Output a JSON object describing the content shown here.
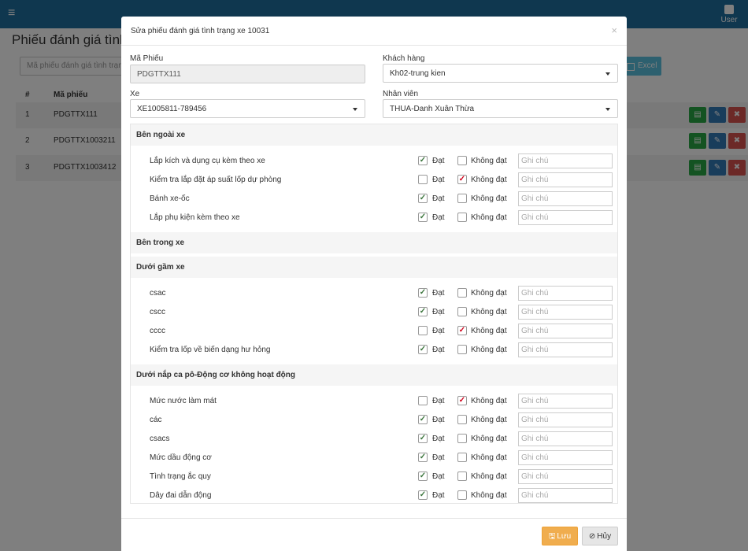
{
  "app": {
    "user_label": "User",
    "page_title": "Phiếu đánh giá tình",
    "search_placeholder": "Mã phiếu đánh giá tình trạng",
    "excel_label": "Excel"
  },
  "table": {
    "headers": [
      "#",
      "Mã phiếu"
    ],
    "rows": [
      {
        "no": "1",
        "code": "PDGTTX111"
      },
      {
        "no": "2",
        "code": "PDGTTX1003211"
      },
      {
        "no": "3",
        "code": "PDGTTX1003412"
      }
    ]
  },
  "modal": {
    "title": "Sửa phiếu đánh giá tình trạng xe 10031",
    "close_glyph": "×",
    "fields": {
      "code_label": "Mã Phiếu",
      "code_value": "PDGTTX111",
      "customer_label": "Khách hàng",
      "customer_value": "Kh02-trung kien",
      "vehicle_label": "Xe",
      "vehicle_value": "XE1005811-789456",
      "staff_label": "Nhân viên",
      "staff_value": "THUA-Danh Xuân Thừa"
    },
    "ok_label": "Đạt",
    "fail_label": "Không đạt",
    "note_placeholder": "Ghi chú",
    "sections": [
      {
        "title": "Bên ngoài xe",
        "items": [
          {
            "label": "Lắp kích và dụng cụ kèm theo xe",
            "ok": true,
            "fail": false
          },
          {
            "label": "Kiểm tra lắp đặt áp suất lốp dự phòng",
            "ok": false,
            "fail": true
          },
          {
            "label": "Bánh xe-ốc",
            "ok": true,
            "fail": false
          },
          {
            "label": "Lắp phụ kiện kèm theo xe",
            "ok": true,
            "fail": false
          }
        ]
      },
      {
        "title": "Bên trong xe",
        "items": []
      },
      {
        "title": "Dưới gầm xe",
        "items": [
          {
            "label": "csac",
            "ok": true,
            "fail": false
          },
          {
            "label": "cscc",
            "ok": true,
            "fail": false
          },
          {
            "label": "cccc",
            "ok": false,
            "fail": true
          },
          {
            "label": "Kiểm tra lốp về biến dạng hư hỏng",
            "ok": true,
            "fail": false
          }
        ]
      },
      {
        "title": "Dưới nắp ca pô-Động cơ không hoạt động",
        "items": [
          {
            "label": "Mức nước làm mát",
            "ok": false,
            "fail": true
          },
          {
            "label": "các",
            "ok": true,
            "fail": false
          },
          {
            "label": "csacs",
            "ok": true,
            "fail": false
          },
          {
            "label": "Mức dầu động cơ",
            "ok": true,
            "fail": false
          },
          {
            "label": "Tình trạng ắc quy",
            "ok": true,
            "fail": false
          },
          {
            "label": "Dây đai dẫn động",
            "ok": true,
            "fail": false
          }
        ]
      }
    ],
    "save_label": "Lưu",
    "cancel_label": "Hủy"
  }
}
